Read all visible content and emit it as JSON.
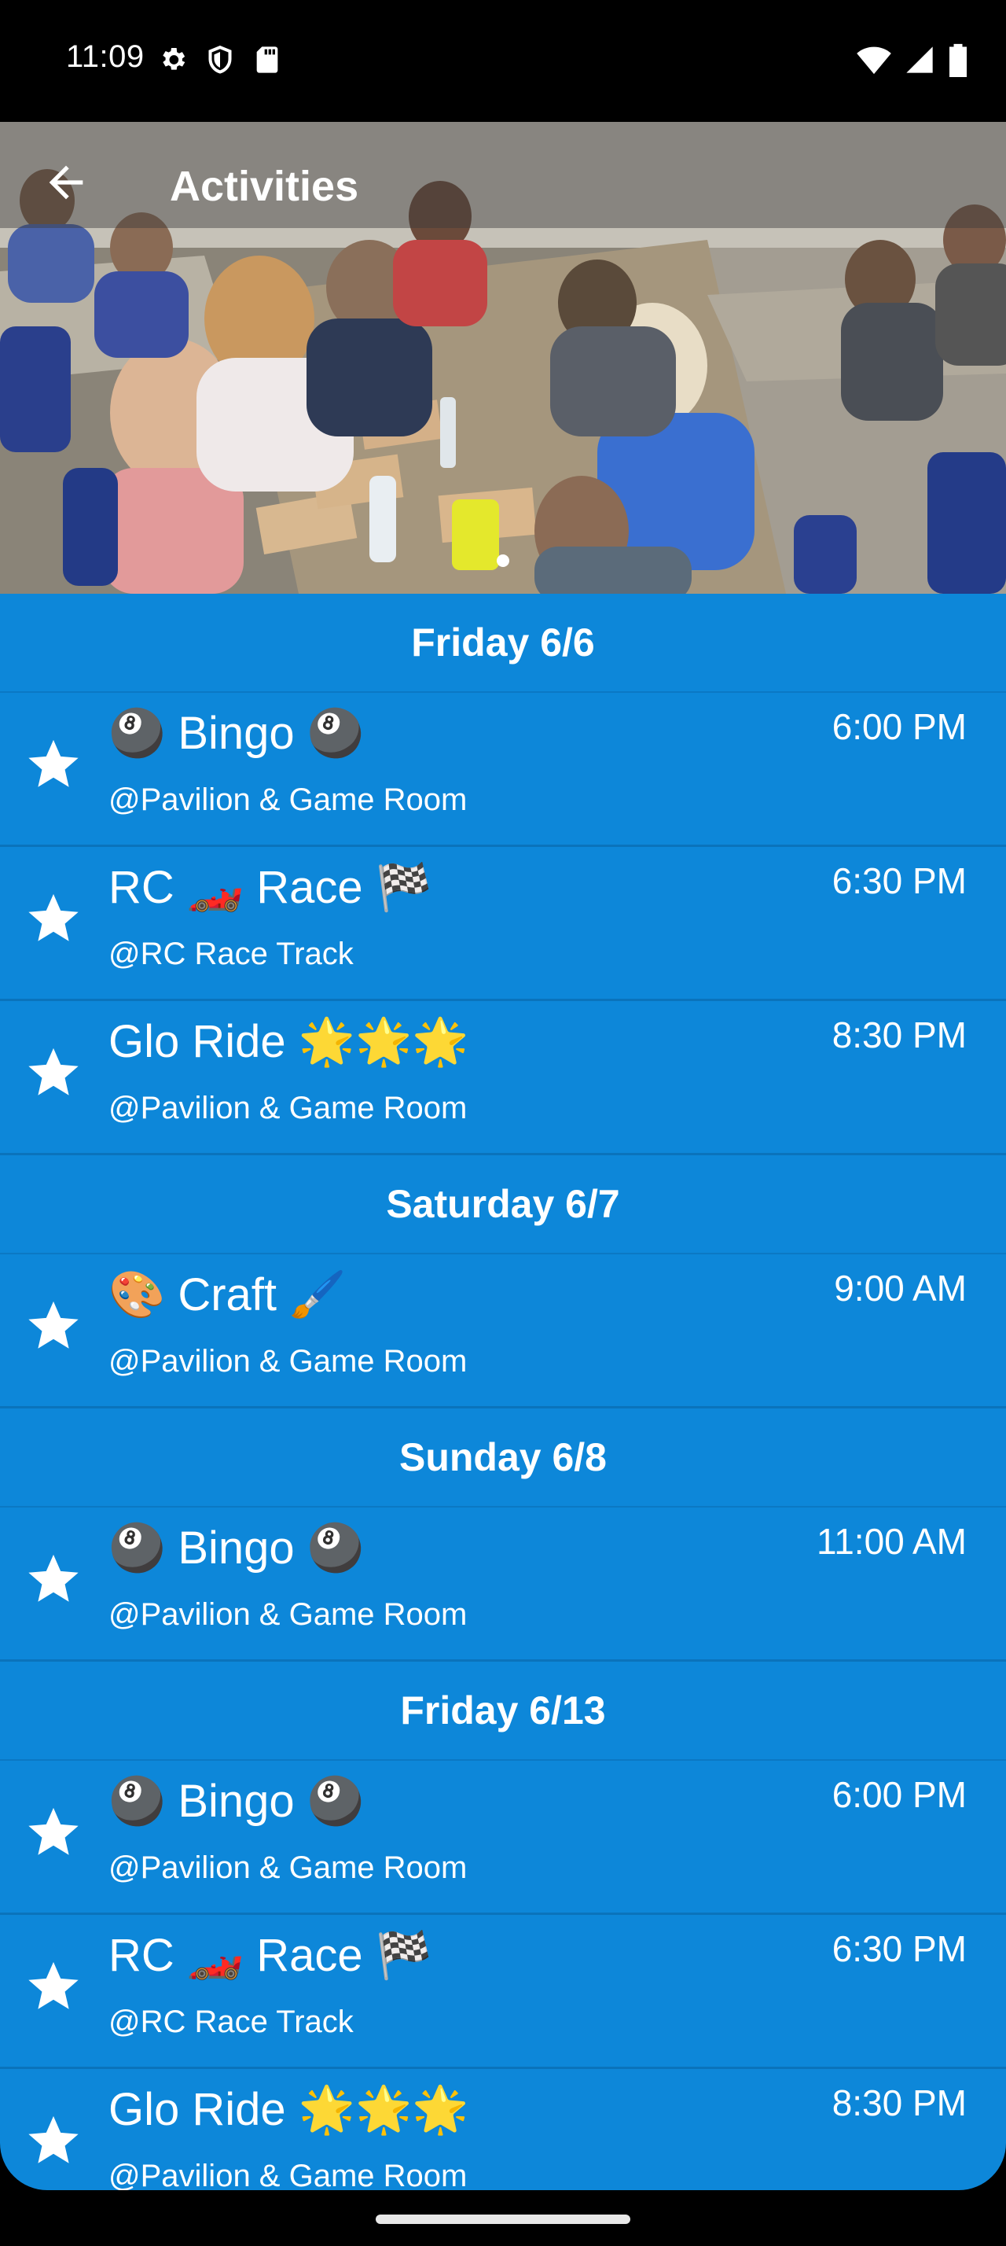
{
  "status_bar": {
    "time": "11:09",
    "left_icons": [
      "gear-icon",
      "shield-icon",
      "sd-card-icon"
    ],
    "right_icons": [
      "wifi-icon",
      "signal-icon",
      "battery-icon"
    ]
  },
  "app_bar": {
    "title": "Activities",
    "back_icon": "arrow-back-icon"
  },
  "carousel": {
    "image": "people playing bingo at tables in pavilion",
    "dots": 2,
    "active_dot": 0
  },
  "colors": {
    "list_background": "#0d87d9",
    "divider": "#0a73bb",
    "text": "#ffffff"
  },
  "schedule": [
    {
      "day": "Friday 6/6",
      "activities": [
        {
          "name": "🎱 Bingo 🎱",
          "location": "@Pavilion & Game Room",
          "time": "6:00 PM"
        },
        {
          "name": "RC 🏎️ Race 🏁",
          "location": "@RC Race Track",
          "time": "6:30 PM"
        },
        {
          "name": "Glo Ride 🌟🌟🌟",
          "location": "@Pavilion & Game Room",
          "time": "8:30 PM"
        }
      ]
    },
    {
      "day": "Saturday 6/7",
      "activities": [
        {
          "name": "🎨 Craft 🖌️",
          "location": "@Pavilion & Game Room",
          "time": "9:00 AM"
        }
      ]
    },
    {
      "day": "Sunday 6/8",
      "activities": [
        {
          "name": "🎱 Bingo 🎱",
          "location": "@Pavilion & Game Room",
          "time": "11:00 AM"
        }
      ]
    },
    {
      "day": "Friday 6/13",
      "activities": [
        {
          "name": "🎱 Bingo 🎱",
          "location": "@Pavilion & Game Room",
          "time": "6:00 PM"
        },
        {
          "name": "RC 🏎️ Race 🏁",
          "location": "@RC Race Track",
          "time": "6:30 PM"
        },
        {
          "name": "Glo Ride 🌟🌟🌟",
          "location": "@Pavilion & Game Room",
          "time": "8:30 PM"
        }
      ]
    }
  ]
}
